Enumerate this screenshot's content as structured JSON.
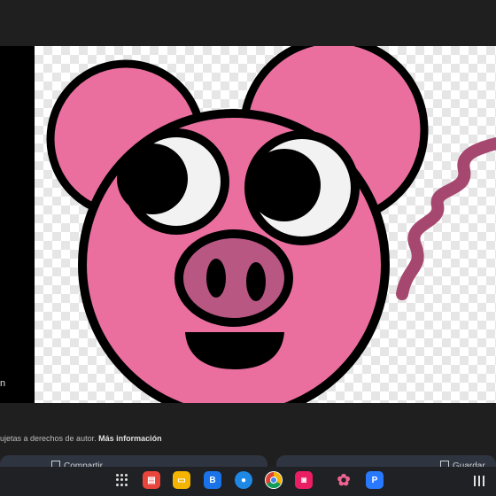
{
  "sidebar": {
    "cut_text": "n"
  },
  "notice": {
    "text": "ujetas a derechos de autor.",
    "link": "Más información"
  },
  "buttons": {
    "share_label": "Compartir",
    "save_label": "Guardar"
  },
  "colors": {
    "pig_pink": "#ea6f9e",
    "snout": "#b95783",
    "tail": "#a6476f",
    "outline": "#000000",
    "eye_white": "#f2f2f2"
  },
  "taskbar": {
    "apps": [
      {
        "icon": "launcher-icon"
      },
      {
        "icon": "slides-app-icon",
        "color": "#e8453c"
      },
      {
        "icon": "files-app-icon",
        "color": "#f5b400"
      },
      {
        "icon": "bookshelf-app-icon",
        "color": "#1a73e8"
      },
      {
        "icon": "messages-app-icon",
        "color": "#1e88e5"
      },
      {
        "icon": "chrome-app-icon",
        "color": "#ffffff"
      },
      {
        "icon": "camera-app-icon",
        "color": "#e91e63"
      },
      {
        "icon": "photos-app-icon",
        "color": "#f06292"
      },
      {
        "icon": "picsart-app-icon",
        "color": "#2979ff"
      }
    ]
  }
}
